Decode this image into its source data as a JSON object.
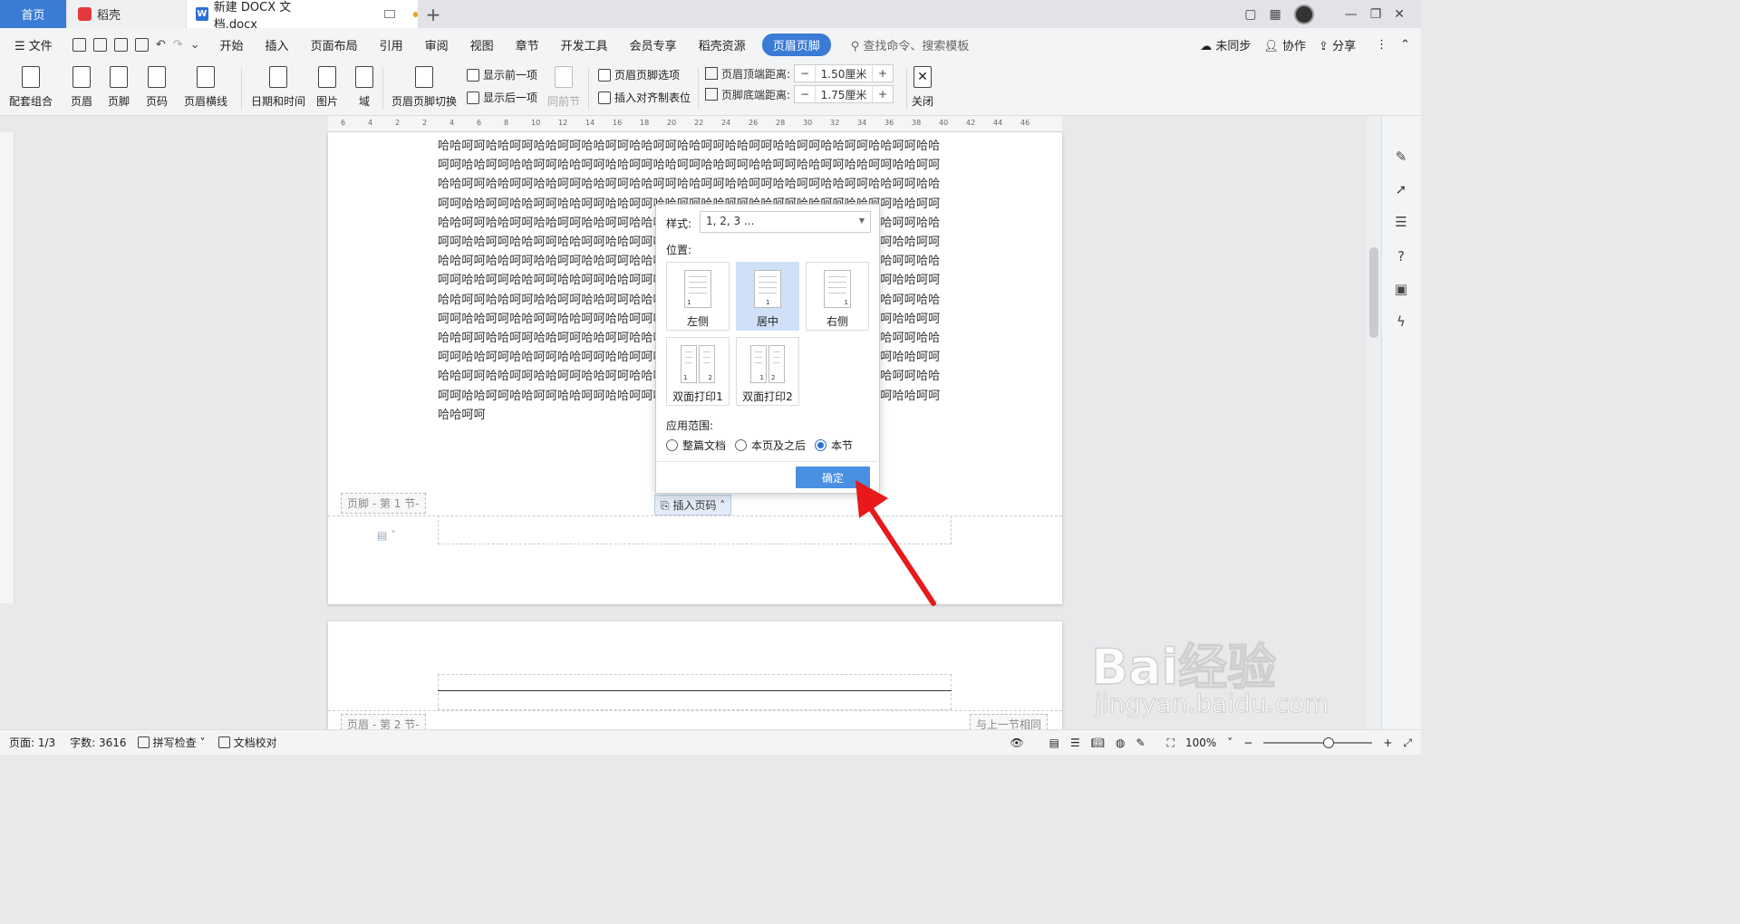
{
  "tabs": {
    "home": "首页",
    "daoke": "稻壳",
    "doc": "新建 DOCX 文档.docx",
    "plus": "+"
  },
  "menubar": {
    "file": "文件",
    "items": [
      "开始",
      "插入",
      "页面布局",
      "引用",
      "审阅",
      "视图",
      "章节",
      "开发工具",
      "会员专享",
      "稻壳资源"
    ],
    "active": "页眉页脚",
    "search_placeholder": "查找命令、搜索模板",
    "sync": "未同步",
    "collab": "协作",
    "share": "分享"
  },
  "ribbon": {
    "combo": "配套组合",
    "header": "页眉",
    "footer": "页脚",
    "pagenum": "页码",
    "header_line": "页眉横线",
    "datetime": "日期和时间",
    "picture": "图片",
    "field": "域",
    "switch": "页眉页脚切换",
    "show_prev": "显示前一项",
    "show_next": "显示后一项",
    "same_prev": "同前节",
    "hf_options": "页眉页脚选项",
    "insert_tab": "插入对齐制表位",
    "header_top_label": "页眉顶端距离:",
    "header_top_value": "1.50厘米",
    "footer_bottom_label": "页脚底端距离:",
    "footer_bottom_value": "1.75厘米",
    "close": "关闭"
  },
  "ruler_marks": [
    "6",
    "4",
    "2",
    "2",
    "4",
    "6",
    "8",
    "10",
    "12",
    "14",
    "16",
    "18",
    "20",
    "22",
    "24",
    "26",
    "28",
    "30",
    "32",
    "34",
    "36",
    "38",
    "40",
    "42",
    "44",
    "46"
  ],
  "document": {
    "body_text": "哈哈呵呵哈哈呵呵哈哈呵呵哈哈呵呵哈哈呵呵哈哈呵呵哈哈呵呵哈哈呵呵哈哈呵呵哈哈呵呵哈哈呵呵哈哈呵呵哈哈呵呵哈哈呵呵哈哈呵呵哈哈呵呵哈哈呵呵哈哈呵呵哈哈呵呵哈哈呵呵哈哈呵呵哈哈呵呵哈哈呵呵哈哈呵呵哈哈呵呵哈哈呵呵哈哈呵呵哈哈呵呵哈哈呵呵哈哈呵呵哈哈呵呵哈哈呵呵哈哈呵呵哈哈呵呵哈哈呵呵哈哈呵呵哈哈呵呵哈哈呵呵哈哈呵呵哈哈呵呵哈哈呵呵哈哈呵呵哈哈呵呵哈哈呵呵哈哈呵呵哈哈呵呵哈哈呵呵哈哈呵呵哈哈呵呵哈哈呵呵哈哈呵呵哈哈呵呵哈哈呵呵哈哈呵呵哈哈呵呵哈哈呵呵哈哈呵呵哈哈呵呵哈哈呵呵哈哈呵呵哈哈呵呵哈哈呵呵哈哈呵呵哈哈呵呵哈哈呵呵哈哈呵呵哈哈呵呵哈哈呵呵哈哈呵呵哈哈呵呵哈哈呵呵哈哈呵呵哈哈呵呵哈哈呵呵哈哈呵呵哈哈呵呵哈哈呵呵哈哈呵呵哈哈呵呵哈哈呵呵哈哈呵呵哈哈呵呵哈哈呵呵哈哈呵呵哈哈呵呵哈哈呵呵哈哈呵呵哈哈呵呵哈哈呵呵哈哈呵呵哈哈呵呵哈哈呵呵哈哈呵呵哈哈呵呵哈哈呵呵哈哈呵呵哈哈呵呵哈哈呵呵哈哈呵呵哈哈呵呵哈哈呵呵哈哈呵呵哈哈呵呵哈哈呵呵哈哈呵呵哈哈呵呵哈哈呵呵哈哈呵呵哈哈呵呵哈哈呵呵哈哈呵呵哈哈呵呵哈哈呵呵哈哈呵呵哈哈呵呵哈哈呵呵哈哈呵呵哈哈呵呵哈哈呵呵哈哈呵呵哈哈呵呵哈哈呵呵哈哈呵呵哈哈呵呵哈哈呵呵哈哈呵呵哈哈呵呵哈哈呵呵哈哈呵呵哈哈呵呵哈哈呵呵哈哈呵呵哈哈呵呵哈哈呵呵哈哈呵呵哈哈呵呵哈哈呵呵哈哈呵呵哈哈呵呵哈哈呵呵哈哈呵呵哈哈呵呵哈哈呵呵哈哈呵呵哈哈呵呵哈哈呵呵哈哈呵呵哈哈呵呵",
    "footer_tag": "页脚 - 第 1 节-",
    "insert_page_number": "插入页码",
    "header_tag": "页眉 - 第 2 节-",
    "same_as_prev": "与上一节相同"
  },
  "popup": {
    "style_label": "样式:",
    "style_value": "1, 2, 3 ...",
    "position_label": "位置:",
    "positions": [
      "左侧",
      "居中",
      "右侧",
      "双面打印1",
      "双面打印2"
    ],
    "range_label": "应用范围:",
    "ranges": [
      "整篇文档",
      "本页及之后",
      "本节"
    ],
    "ok": "确定"
  },
  "statusbar": {
    "page": "页面: 1/3",
    "words": "字数: 3616",
    "spellcheck": "拼写检查",
    "proofread": "文档校对",
    "zoom": "100%"
  },
  "watermark": {
    "main": "Bai经验",
    "sub": "jingyan.baidu.com"
  },
  "colors": {
    "accent": "#3a7bd5",
    "arrow": "#e8191b",
    "ok_button": "#4a90e2"
  }
}
